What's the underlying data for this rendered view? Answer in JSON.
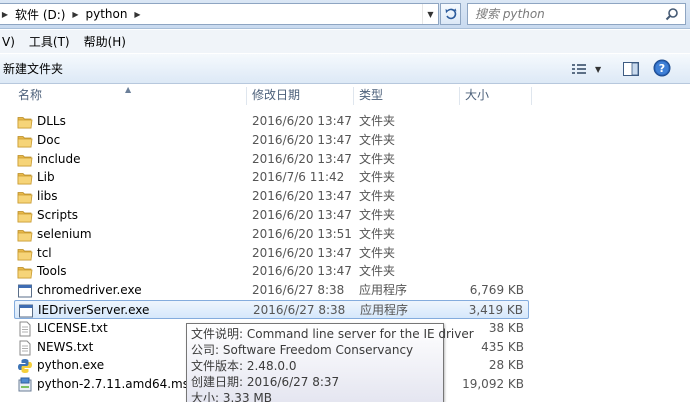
{
  "address": {
    "crumbs": [
      "软件 (D:)",
      "python"
    ],
    "search_placeholder": "搜索 python"
  },
  "menu": {
    "items": [
      "V)",
      "工具(T)",
      "帮助(H)"
    ]
  },
  "toolbar": {
    "new_folder": "新建文件夹"
  },
  "columns": {
    "name": "名称",
    "date": "修改日期",
    "type": "类型",
    "size": "大小"
  },
  "files": [
    {
      "name": "DLLs",
      "date": "2016/6/20 13:47",
      "type": "文件夹",
      "size": "",
      "icon": "folder-icon"
    },
    {
      "name": "Doc",
      "date": "2016/6/20 13:47",
      "type": "文件夹",
      "size": "",
      "icon": "folder-icon"
    },
    {
      "name": "include",
      "date": "2016/6/20 13:47",
      "type": "文件夹",
      "size": "",
      "icon": "folder-icon"
    },
    {
      "name": "Lib",
      "date": "2016/7/6 11:42",
      "type": "文件夹",
      "size": "",
      "icon": "folder-icon"
    },
    {
      "name": "libs",
      "date": "2016/6/20 13:47",
      "type": "文件夹",
      "size": "",
      "icon": "folder-icon"
    },
    {
      "name": "Scripts",
      "date": "2016/6/20 13:47",
      "type": "文件夹",
      "size": "",
      "icon": "folder-icon"
    },
    {
      "name": "selenium",
      "date": "2016/6/20 13:51",
      "type": "文件夹",
      "size": "",
      "icon": "folder-icon"
    },
    {
      "name": "tcl",
      "date": "2016/6/20 13:47",
      "type": "文件夹",
      "size": "",
      "icon": "folder-icon"
    },
    {
      "name": "Tools",
      "date": "2016/6/20 13:47",
      "type": "文件夹",
      "size": "",
      "icon": "folder-icon"
    },
    {
      "name": "chromedriver.exe",
      "date": "2016/6/27 8:38",
      "type": "应用程序",
      "size": "6,769 KB",
      "icon": "exe-icon"
    },
    {
      "name": "IEDriverServer.exe",
      "date": "2016/6/27 8:38",
      "type": "应用程序",
      "size": "3,419 KB",
      "icon": "exe-icon",
      "selected": true
    },
    {
      "name": "LICENSE.txt",
      "date": "",
      "type": "",
      "size": "38 KB",
      "icon": "text-file-icon"
    },
    {
      "name": "NEWS.txt",
      "date": "",
      "type": "",
      "size": "435 KB",
      "icon": "text-file-icon"
    },
    {
      "name": "python.exe",
      "date": "",
      "type": "",
      "size": "28 KB",
      "icon": "python-icon"
    },
    {
      "name": "python-2.7.11.amd64.msi",
      "date": "",
      "type": "",
      "size": "19,092 KB",
      "icon": "installer-icon"
    }
  ],
  "tooltip": {
    "lines": [
      "文件说明: Command line server for the IE driver",
      "公司: Software Freedom Conservancy",
      "文件版本: 2.48.0.0",
      "创建日期: 2016/6/27 8:37",
      "大小: 3.33 MB"
    ]
  }
}
